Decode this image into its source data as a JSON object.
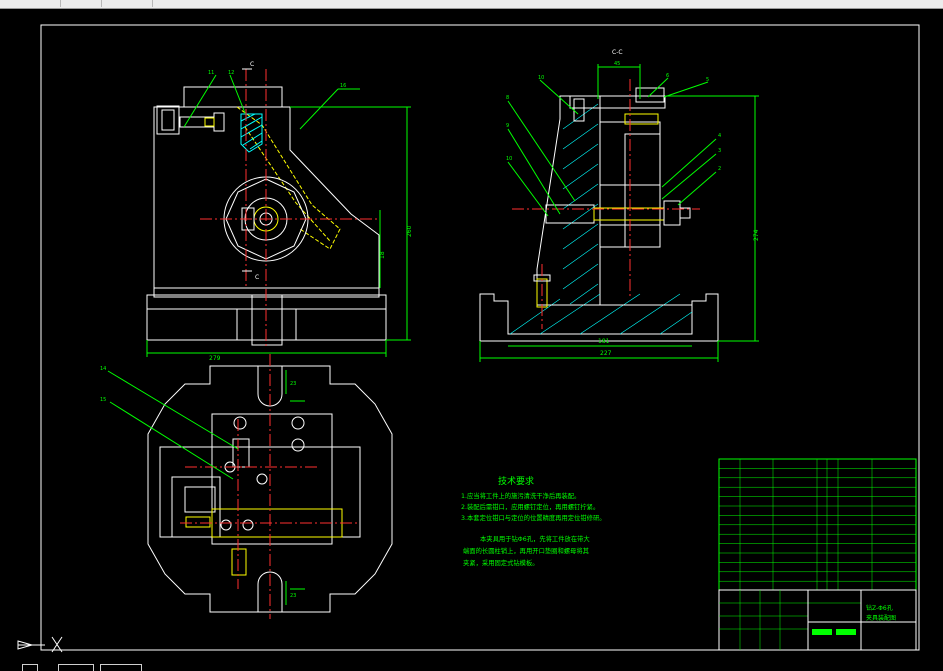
{
  "drawing": {
    "section_label": "C-C",
    "section_mark": "C",
    "tech_title": "技术要求",
    "tech_lines": [
      "1.应当将工件上的施污清洗干净后再装配。",
      "2.装配后需钳口，应用螺钉定位，再用螺钉拧紧。",
      "3.本套定位钳口与定位的位置精度再用定位钳修研。"
    ],
    "note_lines": [
      "本夹具用于钻Φ6孔，先将工件放在带大",
      "端面的长圆柱销上，再用开口垫圈和螺母将其",
      "夹紧，采用固定式钻模板。"
    ],
    "title_block": {
      "part_name": "钻Z-Φ6孔",
      "drawing_name": "夹具装配图"
    },
    "dims": {
      "front_width": "279",
      "front_height": "260",
      "front_right": "18",
      "side_width": "227",
      "side_inner": "181",
      "side_height": "274",
      "side_top": "45",
      "top_small": "23",
      "top_small2": "23"
    },
    "balloons": [
      "11",
      "12",
      "16",
      "1",
      "2",
      "3",
      "4",
      "5",
      "6",
      "7",
      "8",
      "9",
      "10",
      "14",
      "15"
    ]
  },
  "colors": {
    "background": "#000000",
    "outline": "#ffffff",
    "dimension": "#00ff00",
    "centerline": "#ff3030",
    "hidden": "#ffff00",
    "hatch": "#00ffff",
    "leader": "#00ff00",
    "frame": "#ffffff"
  },
  "ucs_icon": "ucs-axis-icon"
}
